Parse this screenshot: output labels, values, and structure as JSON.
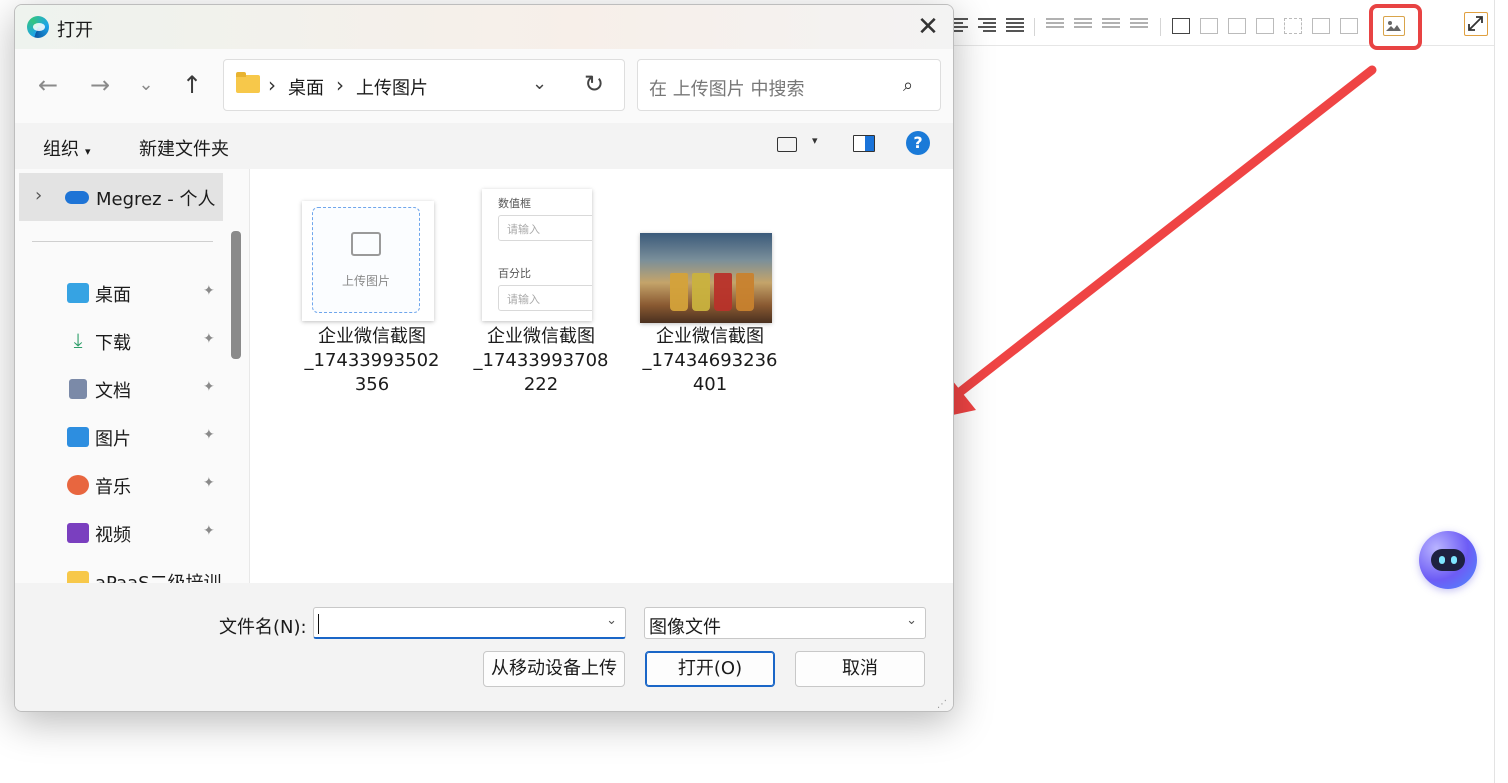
{
  "dialog": {
    "title": "打开",
    "close_glyph": "✕",
    "nav": {
      "back": "←",
      "forward": "→",
      "recent": "⌄",
      "up": "↑"
    },
    "breadcrumb": [
      "桌面",
      "上传图片"
    ],
    "breadcrumb_sep": "›",
    "address_dropdown": "⌄",
    "refresh": "↻",
    "search_placeholder": "在 上传图片 中搜索",
    "search_glyph": "⌕",
    "commands": {
      "organize": "组织",
      "new_folder": "新建文件夹",
      "caret": "▾",
      "help": "?"
    },
    "sidebar": {
      "top_item": "Megrez - 个人",
      "chevron": "›",
      "items": [
        {
          "label": "桌面",
          "icon": "desktop-icon",
          "color": "#36a3e3"
        },
        {
          "label": "下载",
          "icon": "download-icon",
          "color": "#2f9e6a"
        },
        {
          "label": "文档",
          "icon": "documents-icon",
          "color": "#7b8aa8"
        },
        {
          "label": "图片",
          "icon": "pictures-icon",
          "color": "#2d8ee0"
        },
        {
          "label": "音乐",
          "icon": "music-icon",
          "color": "#e8663f"
        },
        {
          "label": "视频",
          "icon": "videos-icon",
          "color": "#7a3fbf"
        },
        {
          "label": "aPaaS二级培训",
          "icon": "folder-icon",
          "color": "#f7c84a"
        }
      ],
      "pin_glyph": "📌"
    },
    "files": [
      {
        "name_line1": "企业微信截图",
        "name_line2": "_17433993502",
        "name_line3": "356",
        "thumb_text": "上传图片"
      },
      {
        "name_line1": "企业微信截图",
        "name_line2": "_17433993708",
        "name_line3": "222",
        "form_label1": "数值框",
        "form_ph1": "请输入",
        "form_label2": "百分比",
        "form_ph2": "请输入"
      },
      {
        "name_line1": "企业微信截图",
        "name_line2": "_17434693236",
        "name_line3": "401"
      }
    ],
    "footer": {
      "filename_label": "文件名(N):",
      "filename_value": "",
      "filter_value": "图像文件",
      "dropdown": "⌄",
      "upload_mobile": "从移动设备上传",
      "open": "打开(O)",
      "cancel": "取消"
    }
  },
  "colors": {
    "arrow": "#ef4444",
    "highlight": "#e84343",
    "accent": "#1a66c7"
  }
}
